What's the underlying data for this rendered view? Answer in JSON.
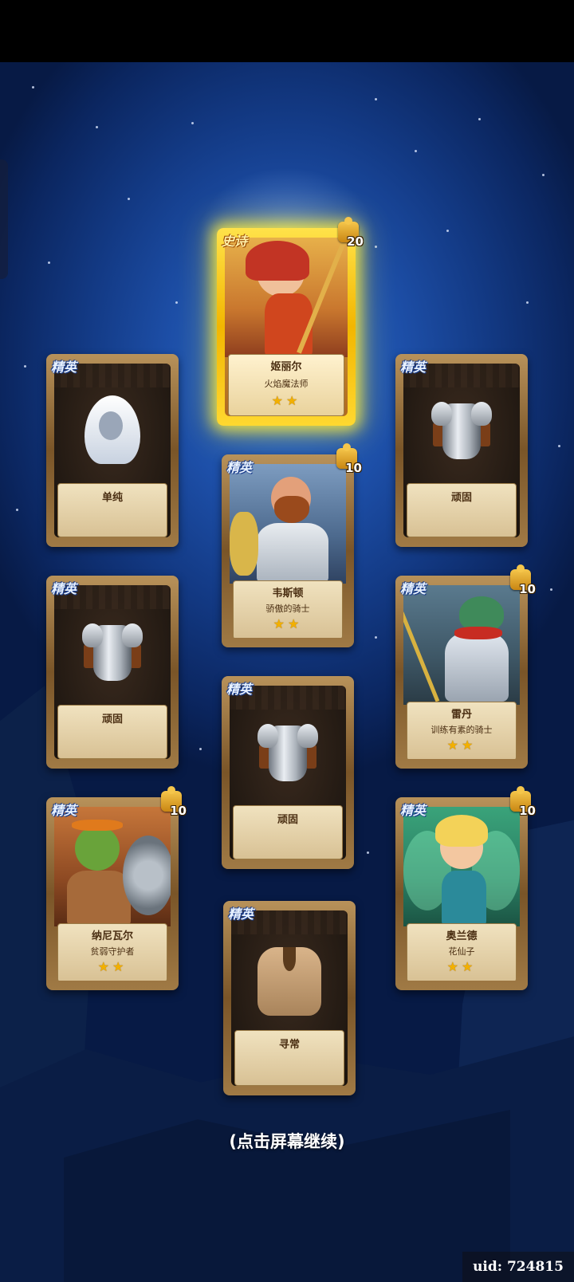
{
  "continue_hint": "(点击屏幕继续)",
  "uid_label": "uid: 724815",
  "cards": {
    "epic_mage": {
      "rarity": "史诗",
      "count": "20",
      "name": "姬丽尔",
      "title": "火焰魔法师",
      "stars": 2
    },
    "hood": {
      "rarity": "精英",
      "name": "单纯"
    },
    "armor_top_right": {
      "rarity": "精英",
      "name": "顽固"
    },
    "knight": {
      "rarity": "精英",
      "count": "10",
      "name": "韦斯顿",
      "title": "骄傲的骑士",
      "stars": 2
    },
    "armor_left": {
      "rarity": "精英",
      "name": "顽固"
    },
    "dragon": {
      "rarity": "精英",
      "count": "10",
      "name": "雷丹",
      "title": "训练有素的骑士",
      "stars": 2
    },
    "armor_center": {
      "rarity": "精英",
      "name": "顽固"
    },
    "goblin": {
      "rarity": "精英",
      "count": "10",
      "name": "纳尼瓦尔",
      "title": "贫弱守护者",
      "stars": 2
    },
    "fairy": {
      "rarity": "精英",
      "count": "10",
      "name": "奥兰德",
      "title": "花仙子",
      "stars": 2
    },
    "vest": {
      "rarity": "精英",
      "name": "寻常"
    }
  },
  "colors": {
    "epic_glow": "#ffe24a",
    "star": "#f2b000",
    "sky": "#1d4fa8"
  }
}
